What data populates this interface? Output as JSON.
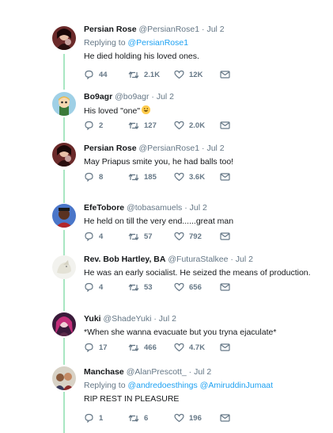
{
  "tweets": [
    {
      "name": "Persian Rose",
      "handle": "@PersianRose1",
      "dot": " · ",
      "time": "Jul 2",
      "replying_prefix": "Replying to ",
      "replying_to": "@PersianRose1",
      "text": "He died holding his loved ones.",
      "replies": "44",
      "retweets": "2.1K",
      "likes": "12K"
    },
    {
      "name": "Bo9agr",
      "handle": "@bo9agr",
      "dot": " · ",
      "time": "Jul 2",
      "text": "His loved \"one\"",
      "emoji": "grinning-face-emoji",
      "replies": "2",
      "retweets": "127",
      "likes": "2.0K"
    },
    {
      "name": "Persian Rose",
      "handle": "@PersianRose1",
      "dot": " · ",
      "time": "Jul 2",
      "text": "May Priapus smite you, he had balls too!",
      "replies": "8",
      "retweets": "185",
      "likes": "3.6K"
    },
    {
      "name": "EfeTobore",
      "handle": "@tobasamuels",
      "dot": " · ",
      "time": "Jul 2",
      "text": "He held on till the very end......great man",
      "replies": "4",
      "retweets": "57",
      "likes": "792"
    },
    {
      "name": "Rev. Bob Hartley, BA",
      "handle": "@FuturaStalkee",
      "dot": " · ",
      "time": "Jul 2",
      "text": "He was an early socialist. He seized the means of production.",
      "replies": "4",
      "retweets": "53",
      "likes": "656"
    },
    {
      "name": "Yuki",
      "handle": "@ShadeYuki",
      "dot": " · ",
      "time": "Jul 2",
      "text": "*When she wanna evacuate but you tryna ejaculate*",
      "replies": "17",
      "retweets": "466",
      "likes": "4.7K"
    },
    {
      "name": "Manchase",
      "handle": "@AlanPrescott_",
      "dot": " · ",
      "time": "Jul 2",
      "replying_prefix": "Replying to ",
      "replying_to": "@andredoesthings @AmiruddinJumaat",
      "text": "RIP REST IN PLEASURE",
      "replies": "1",
      "retweets": "6",
      "likes": "196"
    }
  ],
  "colors": {
    "accent": "#1da1f2",
    "thread_line": "#a8e6c2",
    "muted": "#657786",
    "text": "#14171a"
  },
  "icons": [
    "reply-icon",
    "retweet-icon",
    "like-icon",
    "message-icon"
  ]
}
